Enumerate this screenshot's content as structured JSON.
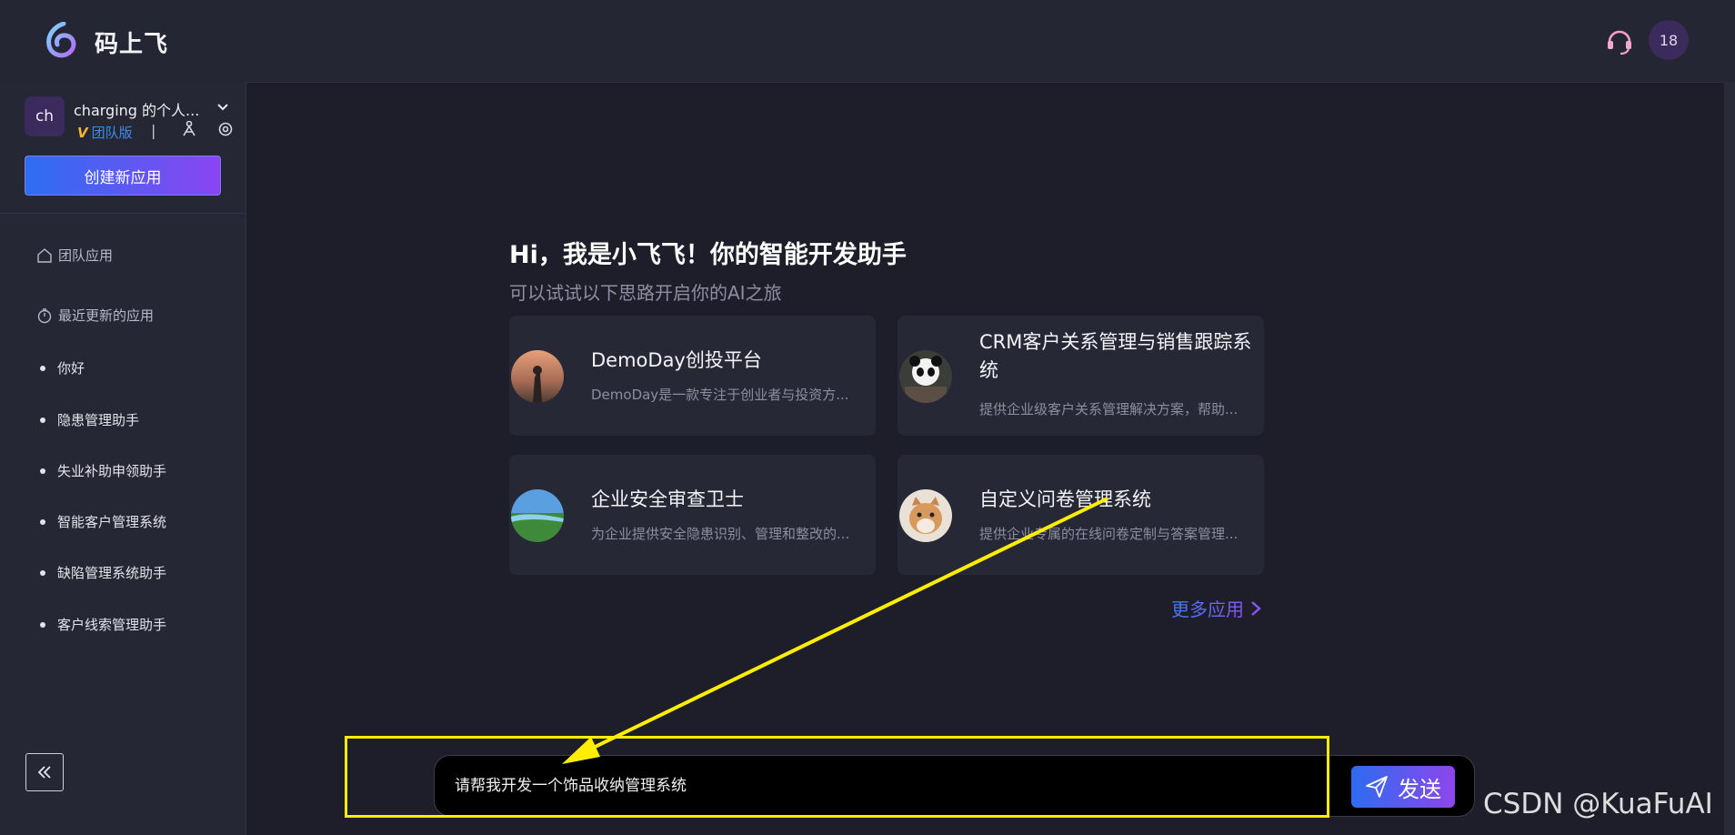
{
  "header": {
    "brand": "码上飞",
    "avatar_text": "18"
  },
  "sidebar": {
    "workspace_avatar": "ch",
    "workspace_name": "charging 的个人...",
    "edition_label": "团队版",
    "separator": "|",
    "create_button": "创建新应用",
    "nav": [
      {
        "label": "团队应用",
        "icon": "home-icon"
      },
      {
        "label": "最近更新的应用",
        "icon": "timer-icon"
      }
    ],
    "recent_apps": [
      "你好",
      "隐患管理助手",
      "失业补助申领助手",
      "智能客户管理系统",
      "缺陷管理系统助手",
      "客户线索管理助手"
    ]
  },
  "main": {
    "greeting_title": "Hi，我是小飞飞！你的智能开发助手",
    "greeting_subtitle": "可以试试以下思路开启你的AI之旅",
    "cards": [
      {
        "title": "DemoDay创投平台",
        "desc": "DemoDay是一款专注于创业者与投资方..."
      },
      {
        "title": "CRM客户关系管理与销售跟踪系统",
        "desc": "提供企业级客户关系管理解决方案，帮助..."
      },
      {
        "title": "企业安全审查卫士",
        "desc": "为企业提供安全隐患识别、管理和整改的..."
      },
      {
        "title": "自定义问卷管理系统",
        "desc": "提供企业专属的在线问卷定制与答案管理..."
      }
    ],
    "more_apps": "更多应用"
  },
  "input": {
    "value": "请帮我开发一个饰品收纳管理系统",
    "send_label": "发送"
  },
  "watermark": "CSDN @KuaFuAI",
  "colors": {
    "background": "#1e1e2b",
    "accent_blue": "#2c6ef2",
    "accent_purple": "#8a45f2",
    "annotation_yellow": "#ffee00"
  }
}
